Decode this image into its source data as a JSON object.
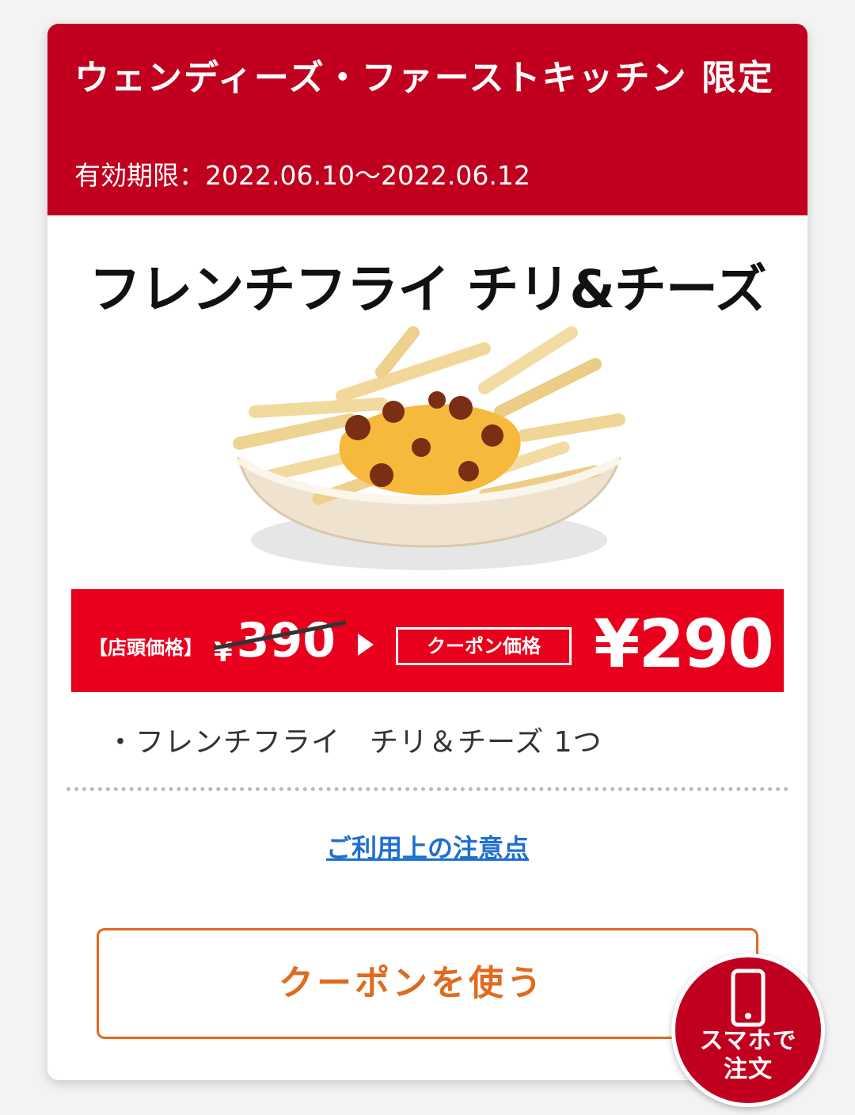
{
  "coupon": {
    "title": "ウェンディーズ・ファーストキッチン 限定",
    "validity": "有効期限：2022.06.10〜2022.06.12",
    "product_name": "フレンチフライ チリ&チーズ",
    "price": {
      "store_label": "【店頭価格】",
      "store_currency": "¥",
      "store_value": "390",
      "coupon_label": "クーポン価格",
      "coupon_price": "¥290"
    },
    "items": [
      "・フレンチフライ　チリ＆チーズ 1つ"
    ],
    "notice_link": "ご利用上の注意点",
    "use_button": "クーポンを使う"
  },
  "fab": {
    "label_line1": "スマホで",
    "label_line2": "注文",
    "icon": "smartphone-icon"
  },
  "colors": {
    "header_red": "#c1001f",
    "price_red": "#e8001d",
    "button_orange": "#e06a1f",
    "link_blue": "#1f6fd1"
  }
}
